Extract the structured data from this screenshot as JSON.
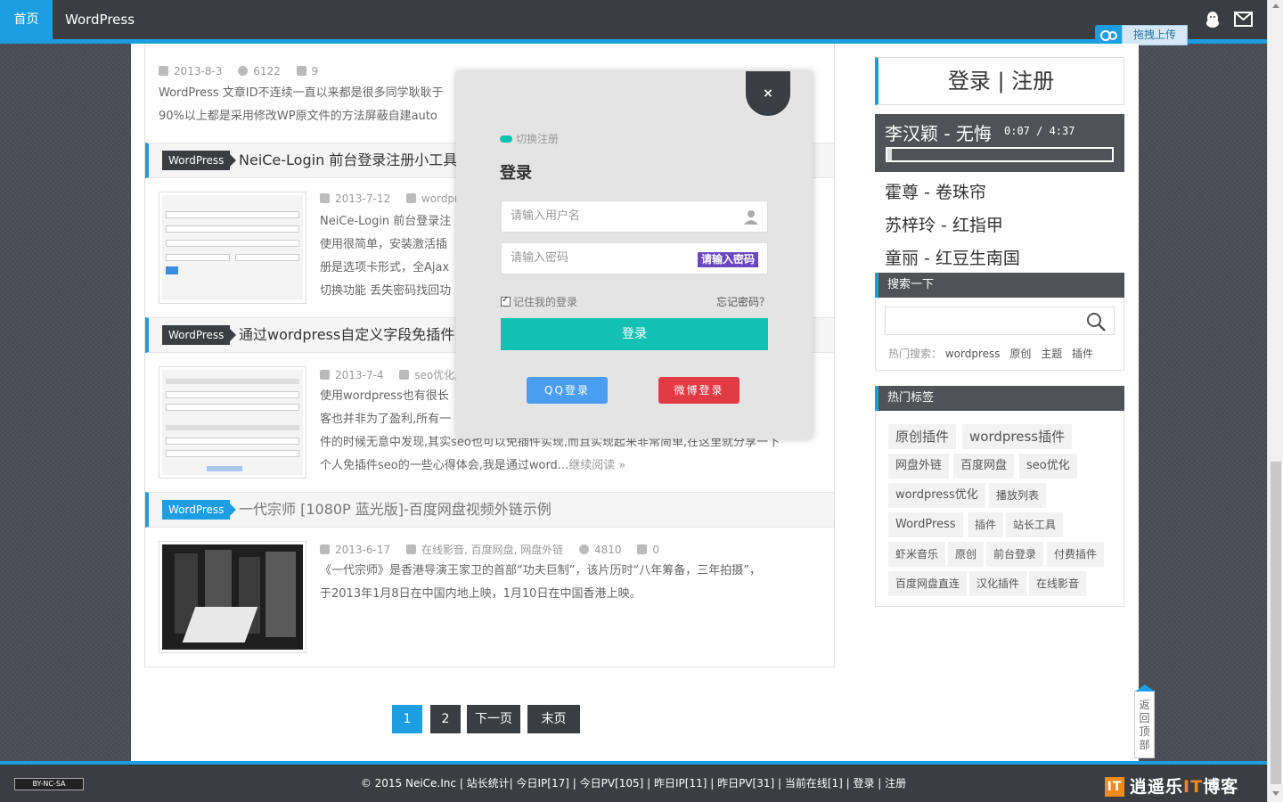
{
  "nav": {
    "home": "首页",
    "wordpress": "WordPress"
  },
  "upload": {
    "label": "拖拽上传"
  },
  "posts": [
    {
      "category": "WordPress",
      "title": "",
      "date": "2013-8-3",
      "views": "6122",
      "comments": "9",
      "excerpt1": "WordPress 文章ID不连续一直以来都是很多同学耿耿于",
      "excerpt2": "90%以上都是采用修改WP原文件的方法屏蔽自建auto"
    },
    {
      "category": "WordPress",
      "title": "NeiCe-Login 前台登录注册小工具",
      "date": "2013-7-12",
      "tags": "wordpr",
      "excerpt1": "NeiCe-Login 前台登录注",
      "excerpt2": "使用很简单，安装激活插",
      "excerpt3": "册是选项卡形式，全Ajax",
      "excerpt4": "切换功能 丢失密码找回功"
    },
    {
      "category": "WordPress",
      "title": "通过wordpress自定义字段免插件",
      "date": "2013-7-4",
      "tags": "seo优化,",
      "excerpt1": "使用wordpress也有很长",
      "excerpt2": "客也并非为了盈利,所有一",
      "excerpt3": "件的时候无意中发现,其实seo也可以免插件实现,而且实现起来非常简单,在这里就分享一下",
      "excerpt4": "个人免插件seo的一些心得体会,我是通过word...",
      "more": "继续阅读 »"
    },
    {
      "category": "WordPress",
      "title": "一代宗师 [1080P 蓝光版]-百度网盘视频外链示例",
      "date": "2013-6-17",
      "tags": "在线影音, 百度网盘, 网盘外链",
      "views": "4810",
      "comments": "0",
      "excerpt1": "《一代宗师》是香港导演王家卫的首部“功夫巨制”，该片历时“八年筹备，三年拍摄”，",
      "excerpt2": "于2013年1月8日在中国内地上映，1月10日在中国香港上映。"
    }
  ],
  "pagination": {
    "p1": "1",
    "p2": "2",
    "next": "下一页",
    "last": "末页"
  },
  "sidebar": {
    "login_register": "登录 | 注册",
    "player": {
      "song": "李汉颖 - 无悔",
      "time": "0:07 / 4:37",
      "progress": 0.02
    },
    "playlist": [
      "霍尊 - 卷珠帘",
      "苏梓玲 - 红指甲",
      "童丽 - 红豆生南国"
    ],
    "search_title": "搜索一下",
    "hot_label": "热门搜索：",
    "hot": [
      "wordpress",
      "原创",
      "主题",
      "插件"
    ],
    "tags_title": "热门标签",
    "tags": [
      "原创插件",
      "wordpress插件",
      "网盘外链",
      "百度网盘",
      "seo优化",
      "wordpress优化",
      "播放列表",
      "WordPress",
      "插件",
      "站长工具",
      "虾米音乐",
      "原创",
      "前台登录",
      "付费插件",
      "百度网盘直连",
      "汉化插件",
      "在线影音"
    ]
  },
  "backtop": {
    "label": "返回顶部"
  },
  "footer": {
    "cc": "BY-NC-SA",
    "text": "© 2015 NeiCe.Inc | 站长统计| 今日IP[17] | 今日PV[105] | 昨日IP[11] | 昨日PV[31] | 当前在线[1] | 登录 | 注册",
    "logo_a": "逍遥",
    "logo_b": "乐",
    "logo_it": "IT",
    "logo_c": "博客"
  },
  "modal": {
    "switch": "切换注册",
    "title": "登录",
    "username_placeholder": "请输入用户名",
    "password_placeholder": "请输入密码",
    "password_tip": "请输入密码",
    "remember": "记住我的登录",
    "forgot": "忘记密码？",
    "login": "登录",
    "qq": "QQ登录",
    "weibo": "微博登录",
    "close": "×"
  }
}
